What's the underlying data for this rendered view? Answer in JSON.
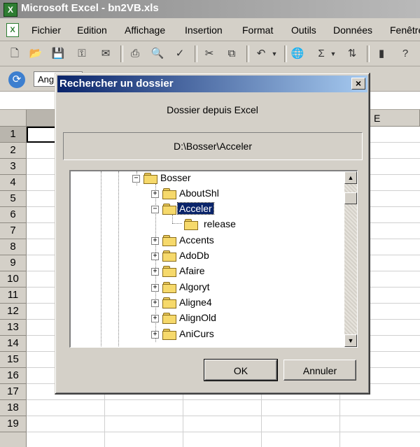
{
  "excel": {
    "title": "Microsoft Excel - bn2VB.xls",
    "app_icon": "X",
    "menus": [
      "Fichier",
      "Edition",
      "Affichage",
      "Insertion",
      "Format",
      "Outils",
      "Données",
      "Fenêtre"
    ],
    "font_name": "Ang",
    "column_label": "E",
    "rows": [
      "1",
      "2",
      "3",
      "4",
      "5",
      "6",
      "7",
      "8",
      "9",
      "10",
      "11",
      "12",
      "13",
      "14",
      "15",
      "16",
      "17",
      "18",
      "19"
    ]
  },
  "dialog": {
    "title": "Rechercher un dossier",
    "close_glyph": "×",
    "subtitle": "Dossier depuis Excel",
    "path": "D:\\Bosser\\Acceler",
    "tree": {
      "root": "Bosser",
      "nodes": [
        "AboutShl",
        "Acceler",
        "release",
        "Accents",
        "AdoDb",
        "Afaire",
        "Algoryt",
        "Aligne4",
        "AlignOld",
        "AniCurs"
      ],
      "selected": "Acceler"
    },
    "ok_label": "OK",
    "cancel_label": "Annuler"
  }
}
